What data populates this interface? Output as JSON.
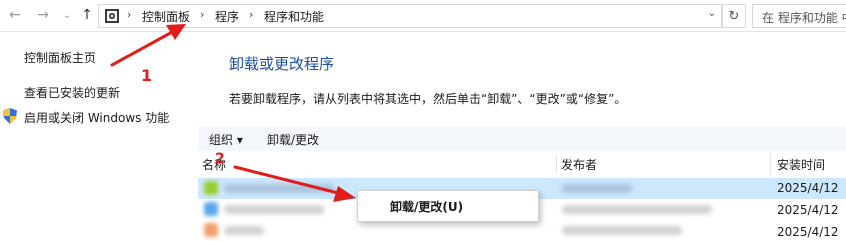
{
  "breadcrumb": {
    "items": [
      "控制面板",
      "程序",
      "程序和功能"
    ]
  },
  "search": {
    "placeholder": "在 程序和功能 中"
  },
  "sidebar": {
    "items": [
      {
        "label": "控制面板主页"
      },
      {
        "label": "查看已安装的更新"
      },
      {
        "label": "启用或关闭 Windows 功能"
      }
    ]
  },
  "main": {
    "heading": "卸载或更改程序",
    "description": "若要卸载程序，请从列表中将其选中，然后单击“卸载”、“更改”或“修复”。"
  },
  "toolbar": {
    "organize_label": "组织 ▾",
    "uninstall_label": "卸载/更改"
  },
  "table": {
    "columns": [
      "名称",
      "发布者",
      "安装时间"
    ],
    "rows": [
      {
        "date": "2025/4/12"
      },
      {
        "date": "2025/4/12"
      },
      {
        "date": "2025/4/12"
      }
    ]
  },
  "context_menu": {
    "item": "卸载/更改(U)"
  },
  "annotations": {
    "step1": "1",
    "step2": "2"
  },
  "colors": {
    "accent_link": "#1e4f9c",
    "selection": "#cce8ff",
    "annotation_red": "#e21b1b"
  }
}
